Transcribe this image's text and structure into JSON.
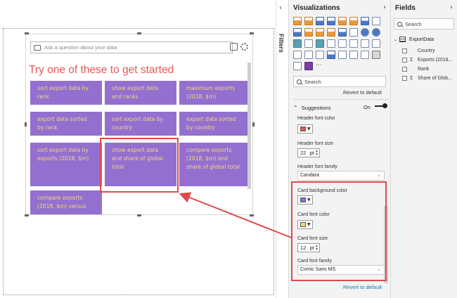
{
  "canvas": {
    "qa_placeholder": "Ask a question about your data",
    "title": "Try one of these to get started",
    "title_color": "#e05a5a",
    "card_background": "#9370cf",
    "card_font_color": "#f3d87c",
    "cards": [
      "sort export data by rank",
      "show export data and ranks",
      "maximum exports (2018, $m)",
      "export data sorted by rank",
      "sort export data by country",
      "export data sorted by country",
      "sort export data by exports (2018, $m)",
      "show export data and share of global total",
      "compare exports (2018, $m) and share of global total",
      "compare exports (2018, $m) versus"
    ]
  },
  "filters": {
    "label": "Filters",
    "chevron": "‹"
  },
  "visualizations": {
    "header": "Visualizations",
    "chevron": "›",
    "search_placeholder": "Search",
    "revert_label": "Revert to default",
    "suggestions_label": "Suggestions",
    "suggestions_state": "On",
    "header_font_color_label": "Header font color",
    "header_font_color": "#e05a5a",
    "header_font_size_label": "Header font size",
    "header_font_size": "22",
    "header_font_size_unit": "pt",
    "header_font_family_label": "Header font family",
    "header_font_family": "Candara",
    "card_bg_color_label": "Card background color",
    "card_bg_color": "#9370cf",
    "card_font_color_label": "Card font color",
    "card_font_color": "#f3d87c",
    "card_font_size_label": "Card font size",
    "card_font_size": "12",
    "card_font_size_unit": "pt",
    "card_font_family_label": "Card font family",
    "card_font_family": "Comic Sans MS",
    "revert_bottom_label": "Revert to default"
  },
  "fields": {
    "header": "Fields",
    "chevron": "›",
    "search_placeholder": "Search",
    "table_name": "ExportData",
    "items": [
      {
        "label": "Country",
        "sigma": false
      },
      {
        "label": "Exports (2018...",
        "sigma": true
      },
      {
        "label": "Rank",
        "sigma": false
      },
      {
        "label": "Share of Glob...",
        "sigma": true
      }
    ]
  }
}
